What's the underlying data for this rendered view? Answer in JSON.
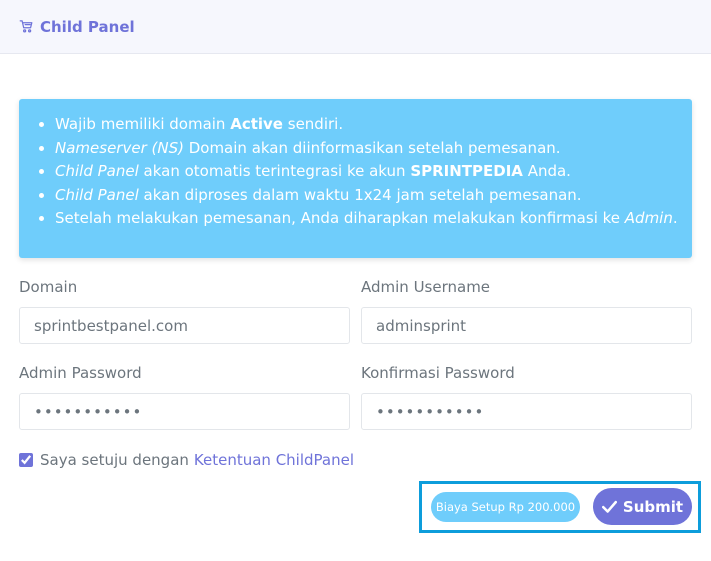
{
  "header": {
    "title": "Child Panel",
    "icon": "cart-icon"
  },
  "notice": {
    "items": [
      {
        "parts": [
          {
            "t": "Wajib memiliki domain ",
            "s": "n"
          },
          {
            "t": "Active",
            "s": "b"
          },
          {
            "t": " sendiri.",
            "s": "n"
          }
        ]
      },
      {
        "parts": [
          {
            "t": "Nameserver (NS)",
            "s": "i"
          },
          {
            "t": " Domain akan diinformasikan setelah pemesanan.",
            "s": "n"
          }
        ]
      },
      {
        "parts": [
          {
            "t": "Child Panel",
            "s": "i"
          },
          {
            "t": " akan otomatis terintegrasi ke akun ",
            "s": "n"
          },
          {
            "t": "SPRINTPEDIA",
            "s": "b"
          },
          {
            "t": " Anda.",
            "s": "n"
          }
        ]
      },
      {
        "parts": [
          {
            "t": "Child Panel",
            "s": "i"
          },
          {
            "t": " akan diproses dalam waktu 1x24 jam setelah pemesanan.",
            "s": "n"
          }
        ]
      },
      {
        "parts": [
          {
            "t": "Setelah melakukan pemesanan, Anda diharapkan melakukan konfirmasi ke ",
            "s": "n"
          },
          {
            "t": "Admin",
            "s": "i"
          },
          {
            "t": ".",
            "s": "n"
          }
        ]
      }
    ]
  },
  "form": {
    "domain_label": "Domain",
    "domain_value": "sprintbestpanel.com",
    "username_label": "Admin Username",
    "username_value": "adminsprint",
    "password_label": "Admin Password",
    "password_value": "•••••••••••",
    "confirm_label": "Konfirmasi Password",
    "confirm_value": "•••••••••••",
    "agree_text": "Saya setuju dengan",
    "agree_link": "Ketentuan ChildPanel",
    "agree_checked": true
  },
  "actions": {
    "fee_label": "Biaya Setup Rp 200.000",
    "submit_label": "Submit"
  },
  "colors": {
    "accent": "#6f73d9",
    "info": "#6fcdfb",
    "highlight": "#0d9ddb"
  }
}
